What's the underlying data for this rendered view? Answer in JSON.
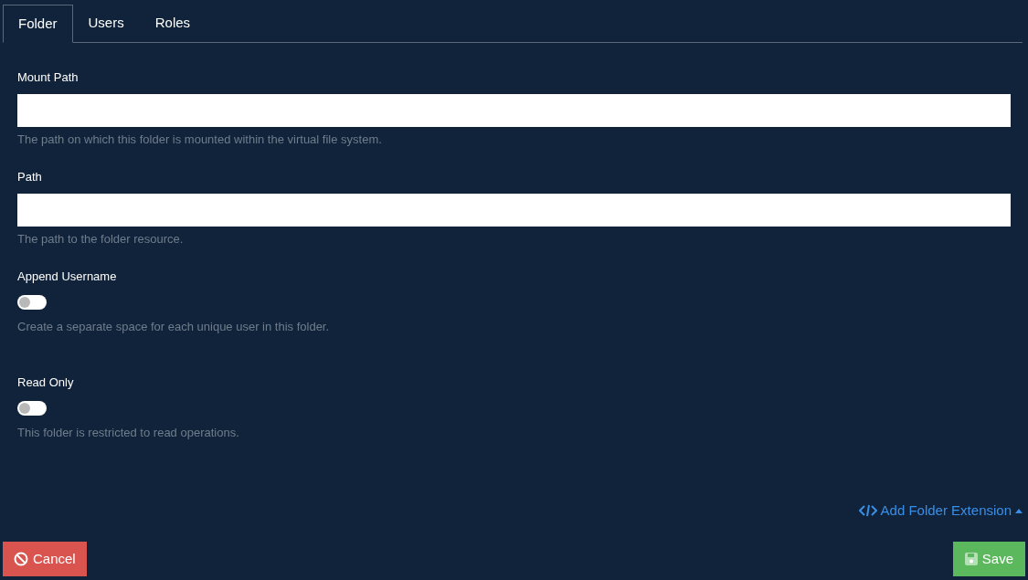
{
  "tabs": [
    {
      "label": "Folder",
      "selected": true
    },
    {
      "label": "Users",
      "selected": false
    },
    {
      "label": "Roles",
      "selected": false
    }
  ],
  "fields": [
    {
      "kind": "text",
      "label": "Mount Path",
      "help": "The path on which this folder is mounted within the virtual file system."
    },
    {
      "kind": "text",
      "label": "Path",
      "help": "The path to the folder resource."
    },
    {
      "kind": "toggle",
      "label": "Append Username",
      "on": false,
      "help": "Create a separate space for each unique user in this folder."
    },
    {
      "kind": "toggle",
      "label": "Read Only",
      "on": false,
      "help": "This folder is restricted to read operations."
    }
  ],
  "extension_link": "Add Folder Extension",
  "buttons": {
    "cancel": "Cancel",
    "save": "Save"
  }
}
